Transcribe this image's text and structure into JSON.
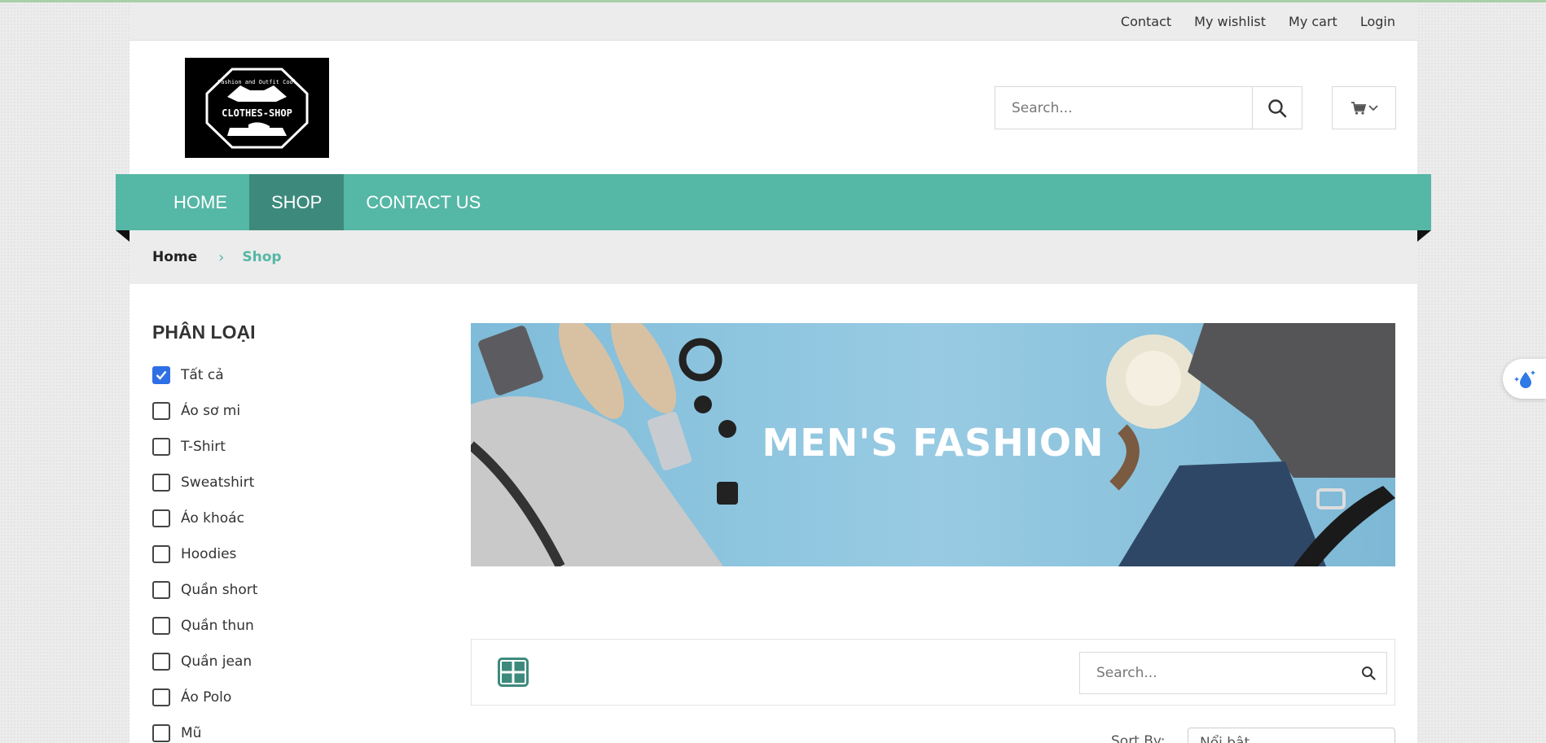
{
  "topbar": {
    "links": [
      "Contact",
      "My wishlist",
      "My cart",
      "Login"
    ]
  },
  "logo": {
    "name": "CLOTHES-SHOP",
    "tagline": "Fashion and Outfit Cool"
  },
  "header": {
    "search_placeholder": "Search...",
    "search_icon": "search-icon",
    "cart_icon": "cart-icon"
  },
  "nav": {
    "items": [
      {
        "label": "HOME",
        "active": false
      },
      {
        "label": "SHOP",
        "active": true
      },
      {
        "label": "CONTACT US",
        "active": false
      }
    ]
  },
  "breadcrumb": {
    "home": "Home",
    "current": "Shop"
  },
  "sidebar": {
    "title": "PHÂN LOẠI",
    "categories": [
      {
        "label": "Tất cả",
        "checked": true
      },
      {
        "label": "Áo sơ mi",
        "checked": false
      },
      {
        "label": "T-Shirt",
        "checked": false
      },
      {
        "label": "Sweatshirt",
        "checked": false
      },
      {
        "label": "Áo khoác",
        "checked": false
      },
      {
        "label": "Hoodies",
        "checked": false
      },
      {
        "label": "Quần short",
        "checked": false
      },
      {
        "label": "Quần thun",
        "checked": false
      },
      {
        "label": "Quần jean",
        "checked": false
      },
      {
        "label": "Áo Polo",
        "checked": false
      },
      {
        "label": "Mũ",
        "checked": false
      }
    ]
  },
  "banner": {
    "title": "MEN'S FASHION"
  },
  "toolbar": {
    "search_placeholder": "Search...",
    "sort_label": "Sort By:",
    "sort_value": "Nổi bật"
  },
  "colors": {
    "accent": "#55b7a5",
    "accent_dark": "#3d8a7d",
    "checkbox": "#2e6fe6"
  }
}
